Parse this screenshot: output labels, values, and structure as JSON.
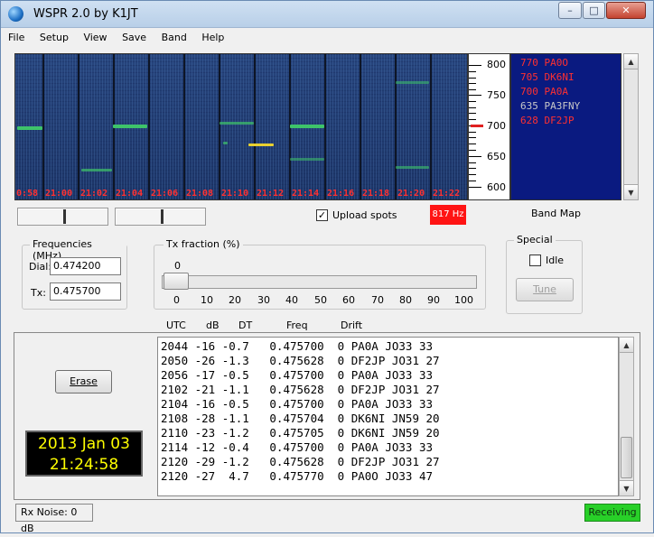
{
  "window": {
    "title": "WSPR 2.0",
    "title_by": "by K1JT"
  },
  "controls": {
    "minimize": "–",
    "maximize": "□",
    "close": "✕"
  },
  "menu": [
    "File",
    "Setup",
    "View",
    "Save",
    "Band",
    "Help"
  ],
  "waterfall": {
    "time_labels": [
      "0:58",
      "21:00",
      "21:02",
      "21:04",
      "21:06",
      "21:08",
      "21:10",
      "21:12",
      "21:14",
      "21:16",
      "21:18",
      "21:20",
      "21:22"
    ]
  },
  "freq_scale": {
    "labels": [
      "800",
      "750",
      "700",
      "650",
      "600"
    ]
  },
  "band_map": [
    {
      "freq": "770",
      "call": "PA0O",
      "color": "#ff3030"
    },
    {
      "freq": "705",
      "call": "DK6NI",
      "color": "#ff3030"
    },
    {
      "freq": "700",
      "call": "PA0A",
      "color": "#ff3030"
    },
    {
      "freq": "635",
      "call": "PA3FNY",
      "color": "#c8c8c8"
    },
    {
      "freq": "628",
      "call": "DF2JP",
      "color": "#ff3030"
    }
  ],
  "upload_spots": {
    "label": "Upload spots",
    "checked": true
  },
  "rx_freq_box": "817 Hz",
  "band_map_label": "Band Map",
  "frequencies": {
    "title": "Frequencies (MHz)",
    "dial_label": "Dial:",
    "dial_value": "0.474200",
    "tx_label": "Tx:",
    "tx_value": "0.475700"
  },
  "tx_fraction": {
    "title": "Tx fraction (%)",
    "value": "0",
    "ticks": [
      "0",
      "10",
      "20",
      "30",
      "40",
      "50",
      "60",
      "70",
      "80",
      "90",
      "100"
    ]
  },
  "special": {
    "title": "Special",
    "idle_label": "Idle",
    "tune_label": "Tune"
  },
  "decode_headers": {
    "utc": "UTC",
    "db": "dB",
    "dt": "DT",
    "freq": "Freq",
    "drift": "Drift"
  },
  "decodes": [
    "2044 -16 -0.7   0.475700  0 PA0A JO33 33",
    "2050 -26 -1.3   0.475628  0 DF2JP JO31 27",
    "2056 -17 -0.5   0.475700  0 PA0A JO33 33",
    "2102 -21 -1.1   0.475628  0 DF2JP JO31 27",
    "2104 -16 -0.5   0.475700  0 PA0A JO33 33",
    "2108 -28 -1.1   0.475704  0 DK6NI JN59 20",
    "2110 -23 -1.2   0.475705  0 DK6NI JN59 20",
    "2114 -12 -0.4   0.475700  0 PA0A JO33 33",
    "2120 -29 -1.2   0.475628  0 DF2JP JO31 27",
    "2120 -27  4.7   0.475770  0 PA0O JO33 47"
  ],
  "erase_label": "Erase",
  "clock": {
    "date": "2013 Jan 03",
    "time": "21:24:58"
  },
  "status": {
    "rx_noise": "Rx Noise: 0 dB",
    "state": "Receiving"
  }
}
